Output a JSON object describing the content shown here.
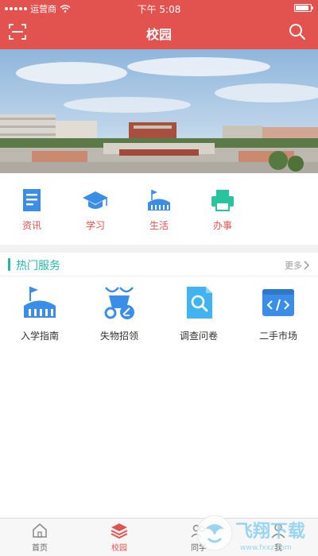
{
  "status": {
    "carrier": "运营商",
    "time": "下午 5:08",
    "battery_level": 0.9
  },
  "header": {
    "title": "校园"
  },
  "quick_links": [
    {
      "label": "资讯",
      "icon": "news-icon"
    },
    {
      "label": "学习",
      "icon": "graduation-cap-icon"
    },
    {
      "label": "生活",
      "icon": "stadium-icon"
    },
    {
      "label": "办事",
      "icon": "printer-icon"
    }
  ],
  "hot_services": {
    "title": "热门服务",
    "more": "更多",
    "items": [
      {
        "label": "入学指南",
        "icon": "stadium-icon"
      },
      {
        "label": "失物招领",
        "icon": "scooter-icon"
      },
      {
        "label": "调查问卷",
        "icon": "document-search-icon"
      },
      {
        "label": "二手市场",
        "icon": "code-window-icon"
      }
    ]
  },
  "tabbar": [
    {
      "label": "首页",
      "icon": "home-icon"
    },
    {
      "label": "校园",
      "icon": "layers-icon"
    },
    {
      "label": "同学",
      "icon": "classmates-icon"
    },
    {
      "label": "我",
      "icon": "user-icon"
    }
  ],
  "watermark": {
    "text": "飞翔下载",
    "url": "www.fxxz.com"
  },
  "colors": {
    "accent": "#e2524f",
    "teal": "#24b7a9",
    "blue": "#3b8ee8"
  }
}
